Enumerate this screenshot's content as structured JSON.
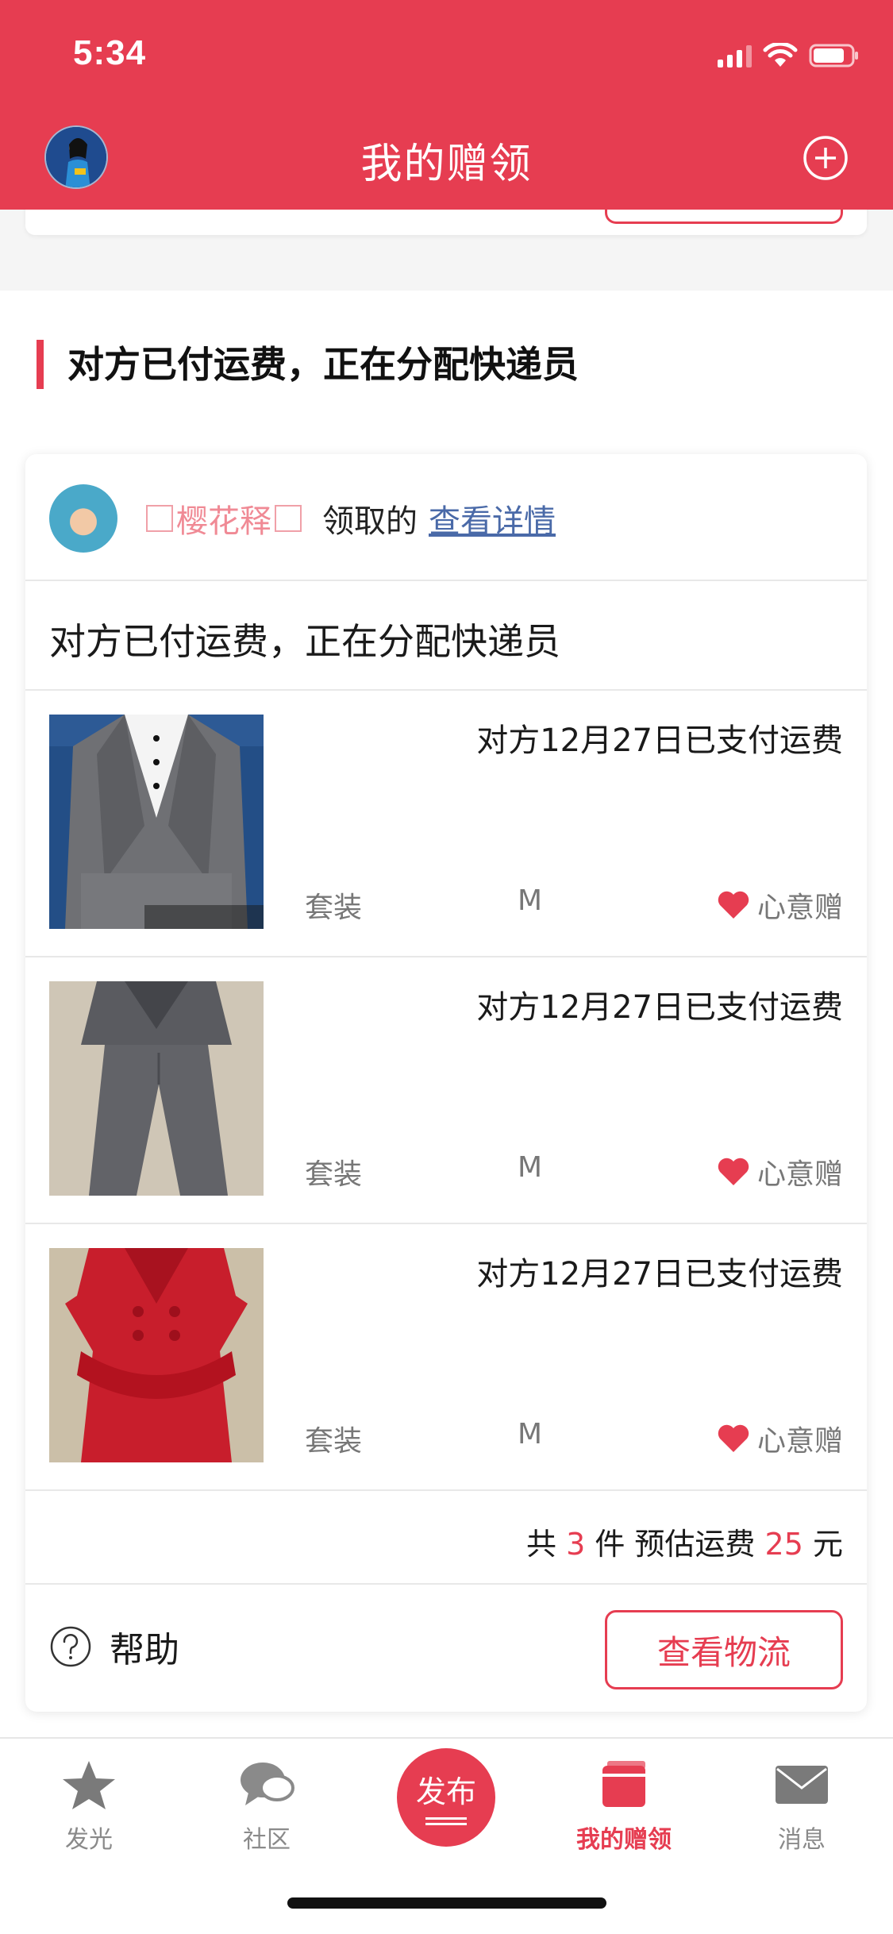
{
  "status_bar": {
    "time": "5:34"
  },
  "nav": {
    "title": "我的赠领"
  },
  "section": {
    "title": "对方已付运费，正在分配快递员"
  },
  "card": {
    "user": {
      "name": "樱花释",
      "action_text": "领取的",
      "detail_link": "查看详情"
    },
    "status_text": "对方已付运费，正在分配快递员",
    "items": [
      {
        "paid_text": "对方12月27日已支付运费",
        "type": "套装",
        "size": "M",
        "gift_label": "心意赠",
        "image": "gray-suit-jacket"
      },
      {
        "paid_text": "对方12月27日已支付运费",
        "type": "套装",
        "size": "M",
        "gift_label": "心意赠",
        "image": "gray-suit-pants"
      },
      {
        "paid_text": "对方12月27日已支付运费",
        "type": "套装",
        "size": "M",
        "gift_label": "心意赠",
        "image": "red-skirt-suit"
      }
    ],
    "summary": {
      "prefix": "共",
      "count": "3",
      "count_unit": "件 预估运费",
      "fee": "25",
      "fee_unit": "元"
    },
    "help_label": "帮助",
    "logistics_button": "查看物流"
  },
  "tabbar": {
    "tabs": [
      {
        "label": "发光",
        "icon": "star-icon"
      },
      {
        "label": "社区",
        "icon": "chat-icon"
      },
      {
        "label": "发布",
        "icon": "publish-icon"
      },
      {
        "label": "我的赠领",
        "icon": "gift-box-icon",
        "active": true
      },
      {
        "label": "消息",
        "icon": "mail-icon"
      }
    ]
  },
  "colors": {
    "brand": "#e63d51",
    "link": "#4a6aa8",
    "muted": "#777777"
  }
}
